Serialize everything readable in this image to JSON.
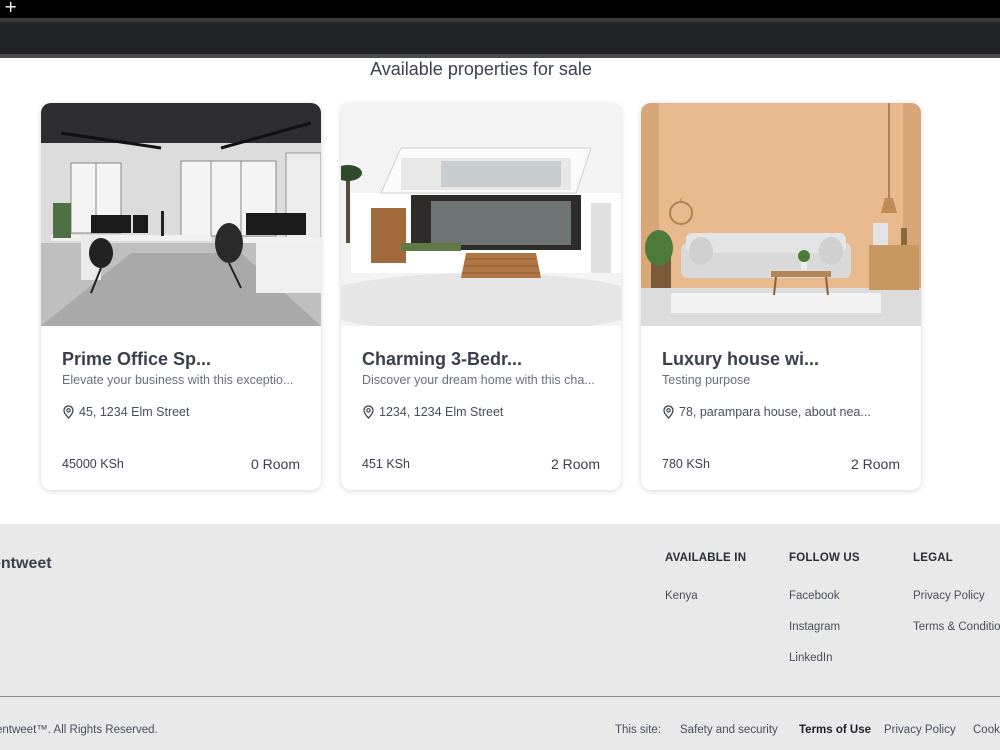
{
  "section_title": "Available properties for sale",
  "properties": [
    {
      "title": "Prime Office Sp...",
      "description": "Elevate your business with this exceptio...",
      "location": "45, 1234 Elm Street",
      "price": "45000 KSh",
      "rooms": "0 Room"
    },
    {
      "title": "Charming 3-Bedr...",
      "description": "Discover your dream home with this cha...",
      "location": "1234, 1234 Elm Street",
      "price": "451 KSh",
      "rooms": "2 Room"
    },
    {
      "title": "Luxury house wi...",
      "description": "Testing purpose",
      "location": "78, parampara house, about nea...",
      "price": "780 KSh",
      "rooms": "2 Room"
    }
  ],
  "footer": {
    "brand": "entweet",
    "available_in": {
      "heading": "AVAILABLE IN",
      "items": [
        "Kenya"
      ]
    },
    "follow_us": {
      "heading": "FOLLOW US",
      "items": [
        "Facebook",
        "Instagram",
        "LinkedIn"
      ]
    },
    "legal": {
      "heading": "LEGAL",
      "items": [
        "Privacy Policy",
        "Terms & Conditio"
      ]
    },
    "copyright": "entweet™. All Rights Reserved.",
    "this_site": "This site:",
    "bottom_links": [
      "Safety and security",
      "Terms of Use",
      "Privacy Policy",
      "Cook"
    ]
  },
  "colors": {
    "footer_bg": "#e9e9e9",
    "card_bg": "#ffffff",
    "topbar": "#000000"
  }
}
